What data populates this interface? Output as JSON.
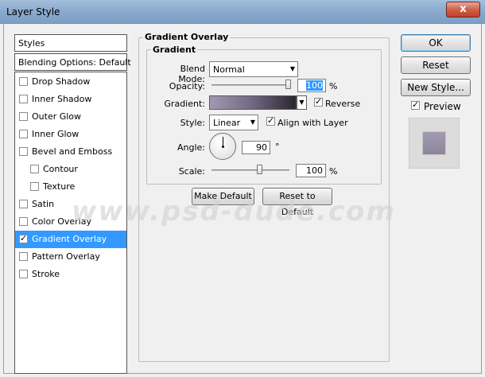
{
  "window": {
    "title": "Layer Style",
    "close_glyph": "x"
  },
  "left": {
    "styles_header": "Styles",
    "blending_options": "Blending Options: Default",
    "items": [
      {
        "label": "Drop Shadow",
        "checked": false,
        "indent": false,
        "selected": false
      },
      {
        "label": "Inner Shadow",
        "checked": false,
        "indent": false,
        "selected": false
      },
      {
        "label": "Outer Glow",
        "checked": false,
        "indent": false,
        "selected": false
      },
      {
        "label": "Inner Glow",
        "checked": false,
        "indent": false,
        "selected": false
      },
      {
        "label": "Bevel and Emboss",
        "checked": false,
        "indent": false,
        "selected": false
      },
      {
        "label": "Contour",
        "checked": false,
        "indent": true,
        "selected": false
      },
      {
        "label": "Texture",
        "checked": false,
        "indent": true,
        "selected": false
      },
      {
        "label": "Satin",
        "checked": false,
        "indent": false,
        "selected": false
      },
      {
        "label": "Color Overlay",
        "checked": false,
        "indent": false,
        "selected": false
      },
      {
        "label": "Gradient Overlay",
        "checked": true,
        "indent": false,
        "selected": true
      },
      {
        "label": "Pattern Overlay",
        "checked": false,
        "indent": false,
        "selected": false
      },
      {
        "label": "Stroke",
        "checked": false,
        "indent": false,
        "selected": false
      }
    ]
  },
  "panel": {
    "group_title": "Gradient Overlay",
    "subgroup_title": "Gradient",
    "blend_mode": {
      "label": "Blend Mode:",
      "value": "Normal"
    },
    "opacity": {
      "label": "Opacity:",
      "value": "100",
      "unit": "%"
    },
    "gradient": {
      "label": "Gradient:",
      "reverse_label": "Reverse",
      "reverse_checked": true
    },
    "style": {
      "label": "Style:",
      "value": "Linear",
      "align_label": "Align with Layer",
      "align_checked": true
    },
    "angle": {
      "label": "Angle:",
      "value": "90",
      "unit": "°"
    },
    "scale": {
      "label": "Scale:",
      "value": "100",
      "unit": "%"
    },
    "make_default": "Make Default",
    "reset_default": "Reset to Default"
  },
  "right": {
    "ok": "OK",
    "reset": "Reset",
    "new_style": "New Style...",
    "preview_label": "Preview",
    "preview_checked": true
  },
  "watermark": "www.psd-dude.com"
}
